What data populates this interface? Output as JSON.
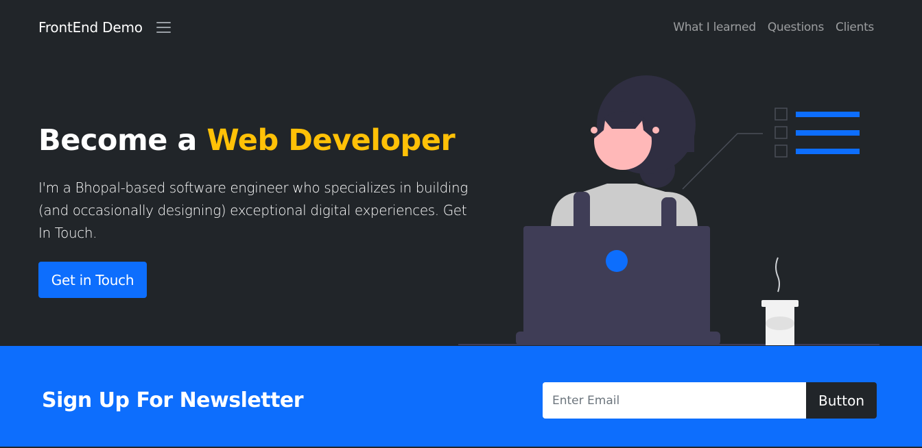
{
  "nav": {
    "brand": "FrontEnd Demo",
    "toggle_icon": "hamburger-icon",
    "links": [
      "What I learned",
      "Questions",
      "Clients"
    ]
  },
  "hero": {
    "title_plain": "Become a ",
    "title_accent": "Web Developer",
    "description": "I'm a Bhopal-based software engineer who specializes in building (and occasionally designing) exceptional digital experiences. Get In Touch.",
    "cta_label": "Get in Touch",
    "illustration": "developer-at-laptop-illustration"
  },
  "newsletter": {
    "title": "Sign Up For Newsletter",
    "email_placeholder": "Enter Email",
    "email_value": "",
    "button_label": "Button"
  },
  "colors": {
    "background": "#212529",
    "accent": "#ffc107",
    "primary": "#0d6efd"
  }
}
